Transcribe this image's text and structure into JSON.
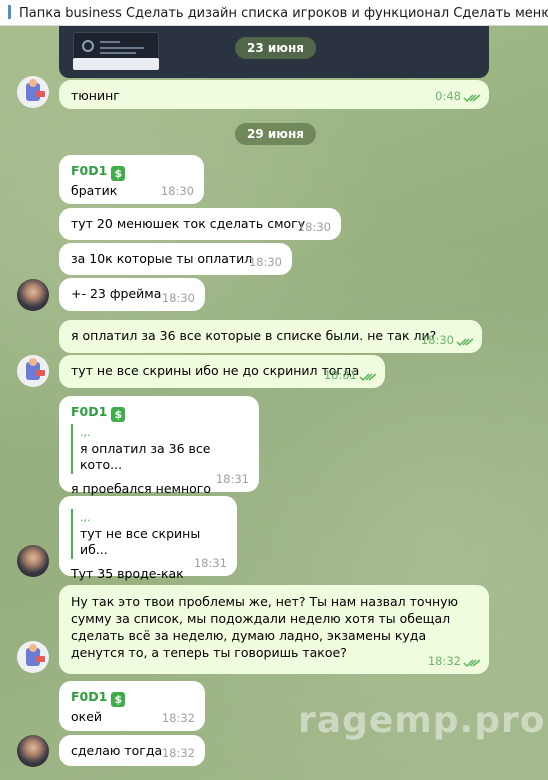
{
  "header": {
    "title": "Папка business  Сделать дизайн списка игроков и функционал Сделать менюшку со"
  },
  "dates": {
    "first": "23 июня",
    "second": "29 июня"
  },
  "messages": [
    {
      "text": "тюнинг",
      "time": "0:48"
    },
    {
      "sender": "F0D1",
      "text": "братик",
      "time": "18:30"
    },
    {
      "text": "тут 20 менюшек ток сделать смогу",
      "time": "18:30"
    },
    {
      "text": "за 10к которые ты оплатил",
      "time": "18:30"
    },
    {
      "text": "+- 23 фрейма",
      "time": "18:30"
    },
    {
      "text": "я оплатил за 36 все которые в списке были. не так ли?",
      "time": "18:30"
    },
    {
      "text": "тут не все скрины ибо не до скринил тогда",
      "time": "18:31"
    },
    {
      "sender": "F0D1",
      "quote_name": ".,.",
      "quote_text": "я оплатил за 36 все кото...",
      "text": "я проебался немного",
      "time": "18:31"
    },
    {
      "quote_name": ".,.",
      "quote_text": "тут не все скрины иб...",
      "text": "Тут 35 вроде-как",
      "time": "18:31"
    },
    {
      "text": "Ну так это твои проблемы же, нет? Ты нам назвал точную сумму за список, мы подождали неделю хотя ты обещал сделать всё за неделю, думаю ладно, экзамены куда денутся то, а теперь ты говоришь такое?",
      "time": "18:32"
    },
    {
      "sender": "F0D1",
      "text": "окей",
      "time": "18:32"
    },
    {
      "text": "сделаю тогда",
      "time": "18:32"
    }
  ],
  "icons": {
    "sender_badge": "dollar-badge-icon",
    "read_status": "double-check-icon"
  },
  "watermark": "ragemp.pro",
  "colors": {
    "sender": "#2f9e3e",
    "outgoing_bubble": "#effdde",
    "incoming_bubble": "#ffffff"
  }
}
